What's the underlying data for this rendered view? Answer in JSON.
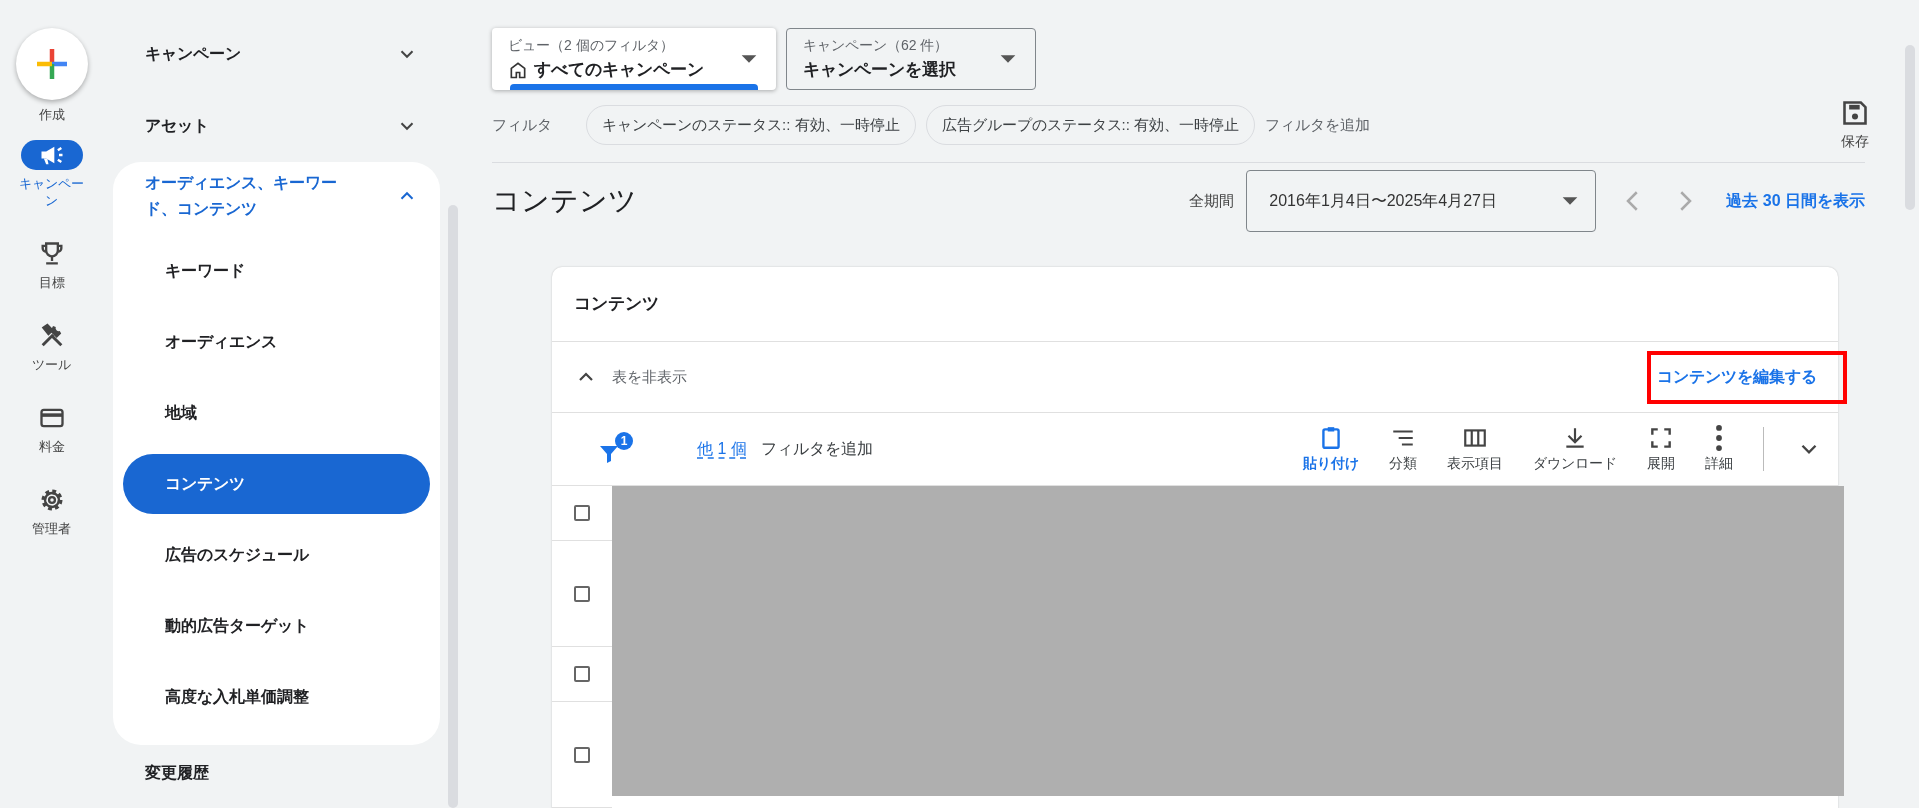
{
  "rail": {
    "create_label": "作成",
    "items": [
      {
        "label": "キャンペーン",
        "selected": true
      },
      {
        "label": "目標",
        "selected": false
      },
      {
        "label": "ツール",
        "selected": false
      },
      {
        "label": "料金",
        "selected": false
      },
      {
        "label": "管理者",
        "selected": false
      }
    ]
  },
  "sidebar": {
    "items": [
      {
        "label": "キャンペーン",
        "expanded": false
      },
      {
        "label": "アセット",
        "expanded": false
      },
      {
        "label": "オーディエンス、キーワード、コンテンツ",
        "expanded": true,
        "children": [
          {
            "label": "キーワード",
            "selected": false
          },
          {
            "label": "オーディエンス",
            "selected": false
          },
          {
            "label": "地域",
            "selected": false
          },
          {
            "label": "コンテンツ",
            "selected": true
          },
          {
            "label": "広告のスケジュール",
            "selected": false
          },
          {
            "label": "動的広告ターゲット",
            "selected": false
          },
          {
            "label": "高度な入札単価調整",
            "selected": false
          }
        ]
      },
      {
        "label": "変更履歴"
      }
    ]
  },
  "view_selector": {
    "label": "ビュー（2 個のフィルタ）",
    "value": "すべてのキャンペーン"
  },
  "campaign_selector": {
    "label": "キャンペーン（62 件）",
    "value": "キャンペーンを選択"
  },
  "filters": {
    "label": "フィルタ",
    "chips": [
      "キャンペーンのステータス:: 有効、一時停止",
      "広告グループのステータス:: 有効、一時停止"
    ],
    "add": "フィルタを追加",
    "save": "保存"
  },
  "page": {
    "title": "コンテンツ",
    "period_label": "全期間",
    "date_range": "2016年1月4日〜2025年4月27日",
    "recent_link": "過去 30 日間を表示"
  },
  "card": {
    "title": "コンテンツ",
    "hide_table": "表を非表示",
    "edit_link": "コンテンツを編集する",
    "edit_highlighted": true,
    "filter_badge": "1",
    "more_filters": "他 1 個",
    "add_filter": "フィルタを追加",
    "tools": [
      {
        "label": "貼り付け",
        "selected": true
      },
      {
        "label": "分類",
        "selected": false
      },
      {
        "label": "表示項目",
        "selected": false
      },
      {
        "label": "ダウンロード",
        "selected": false
      },
      {
        "label": "展開",
        "selected": false
      },
      {
        "label": "詳細",
        "selected": false
      }
    ],
    "rows": [
      {
        "checked": false
      },
      {
        "checked": false
      },
      {
        "checked": false
      },
      {
        "checked": false
      }
    ]
  }
}
